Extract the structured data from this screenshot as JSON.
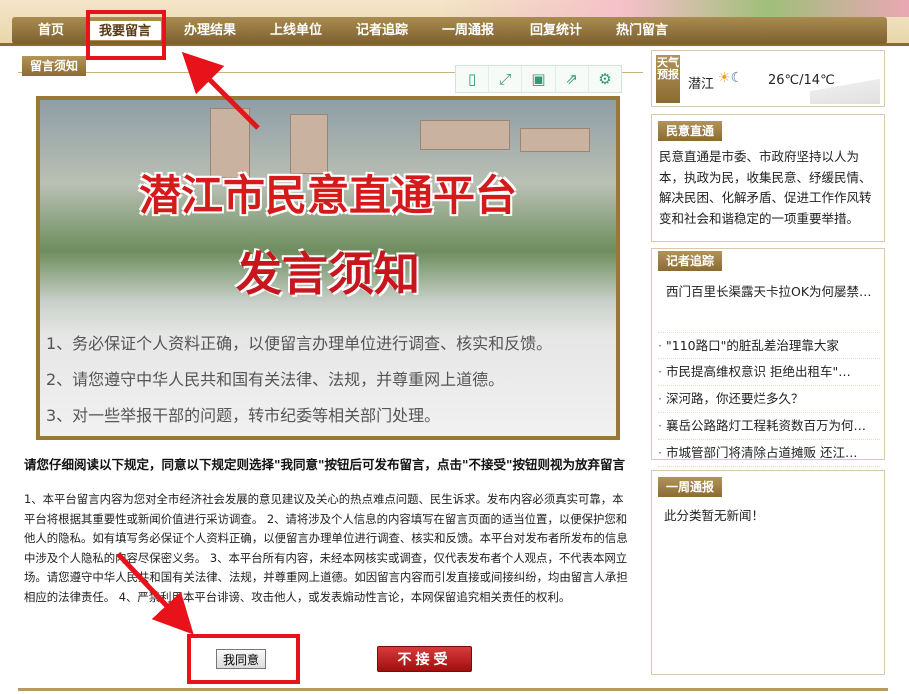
{
  "nav": {
    "items": [
      "首页",
      "我要留言",
      "办理结果",
      "上线单位",
      "记者追踪",
      "一周通报",
      "回复统计",
      "热门留言"
    ],
    "active_index": 1
  },
  "notice": {
    "tag": "留言须知",
    "toolbar_icons": [
      "mobile-icon",
      "fullscreen-icon",
      "save-icon",
      "share-icon",
      "settings-icon"
    ]
  },
  "banner": {
    "title": "潜江市民意直通平台",
    "subtitle": "发言须知",
    "rules": [
      "1、务必保证个人资料正确，以便留言办理单位进行调查、核实和反馈。",
      "2、请您遵守中华人民共和国有关法律、法规，并尊重网上道德。",
      "3、对一些举报干部的问题，转市纪委等相关部门处理。"
    ]
  },
  "intro": "请您仔细阅读以下规定，同意以下规定则选择\"我同意\"按钮后可发布留言，点击\"不接受\"按钮则视为放弃留言",
  "rules_text": "1、本平台留言内容为您对全市经济社会发展的意见建议及关心的热点难点问题、民生诉求。发布内容必须真实可靠，本平台将根据其重要性或新闻价值进行采访调查。 2、请将涉及个人信息的内容填写在留言页面的适当位置，以便保护您和他人的隐私。如有填写务必保证个人资料正确，以便留言办理单位进行调查、核实和反馈。本平台对发布者所发布的信息中涉及个人隐私的内容尽保密义务。 3、本平台所有内容，未经本网核实或调查，仅代表发布者个人观点，不代表本网立场。请您遵守中华人民共和国有关法律、法规，并尊重网上道德。如因留言内容而引发直接或间接纠纷，均由留言人承担相应的法律责任。 4、严禁利用本平台诽谤、攻击他人，或发表煽动性言论，本网保留追究相关责任的权利。",
  "buttons": {
    "agree": "我同意",
    "reject": "不接受"
  },
  "weather": {
    "badge": "天气预报",
    "city": "潜江",
    "icons": [
      "sun-cloud-icon",
      "moon-cloud-icon"
    ],
    "temp": "26℃/14℃"
  },
  "sidebar": {
    "minyi": {
      "tag": "民意直通",
      "text": "民意直通是市委、市政府坚持以人为本，执政为民，收集民意、纾缓民情、解决民困、化解矛盾、促进工作作风转变和社会和谐稳定的一项重要举措。"
    },
    "reporter": {
      "tag": "记者追踪",
      "items": [
        "西门百里长渠露天卡拉OK为何屡禁…",
        "\"110路口\"的脏乱差治理靠大家",
        "市民提高维权意识 拒绝出租车\"…",
        "深河路，你还要烂多久？",
        "襄岳公路路灯工程耗资数百万为何…",
        "市城管部门将清除占道摊贩 还江…"
      ]
    },
    "weekly": {
      "tag": "一周通报",
      "text": "此分类暂无新闻！"
    }
  },
  "colors": {
    "nav_bar": "#8c6a2c",
    "highlight": "#e8121b",
    "banner_title": "#d41a1a",
    "reject_button": "#c01818"
  }
}
